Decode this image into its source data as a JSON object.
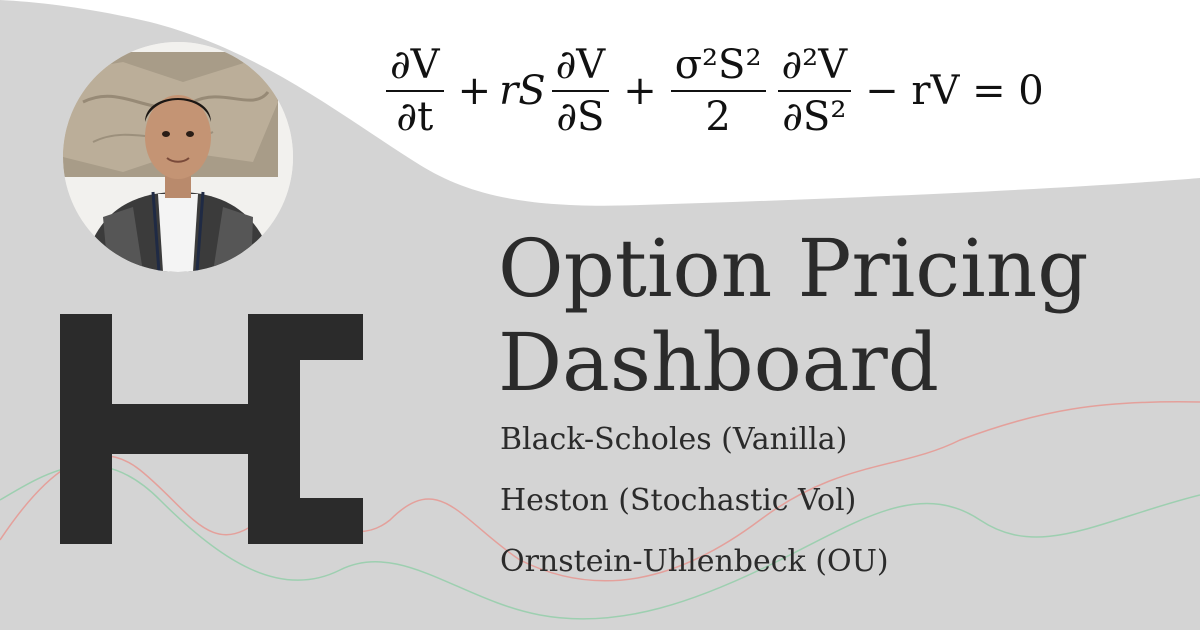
{
  "formula": {
    "t1_num": "∂V",
    "t1_den": "∂t",
    "plus1": "+",
    "t2_coef": "rS",
    "t2_num": "∂V",
    "t2_den": "∂S",
    "plus2": "+",
    "t3_num": "σ²S²",
    "t3_den": "2",
    "t4_num": "∂²V",
    "t4_den": "∂S²",
    "tail": "− rV = 0"
  },
  "title_line1": "Option Pricing",
  "title_line2": "Dashboard",
  "models": [
    "Black-Scholes (Vanilla)",
    "Heston (Stochastic Vol)",
    "Ornstein-Uhlenbeck (OU)"
  ],
  "colors": {
    "background": "#d4d4d4",
    "top_band": "#ffffff",
    "text": "#2b2b2b",
    "logo": "#2b2b2b",
    "line_red": "#e4a09b",
    "line_green": "#9dcfb0"
  },
  "icons": {
    "logo": "he-monogram-logo",
    "avatar": "profile-photo"
  }
}
